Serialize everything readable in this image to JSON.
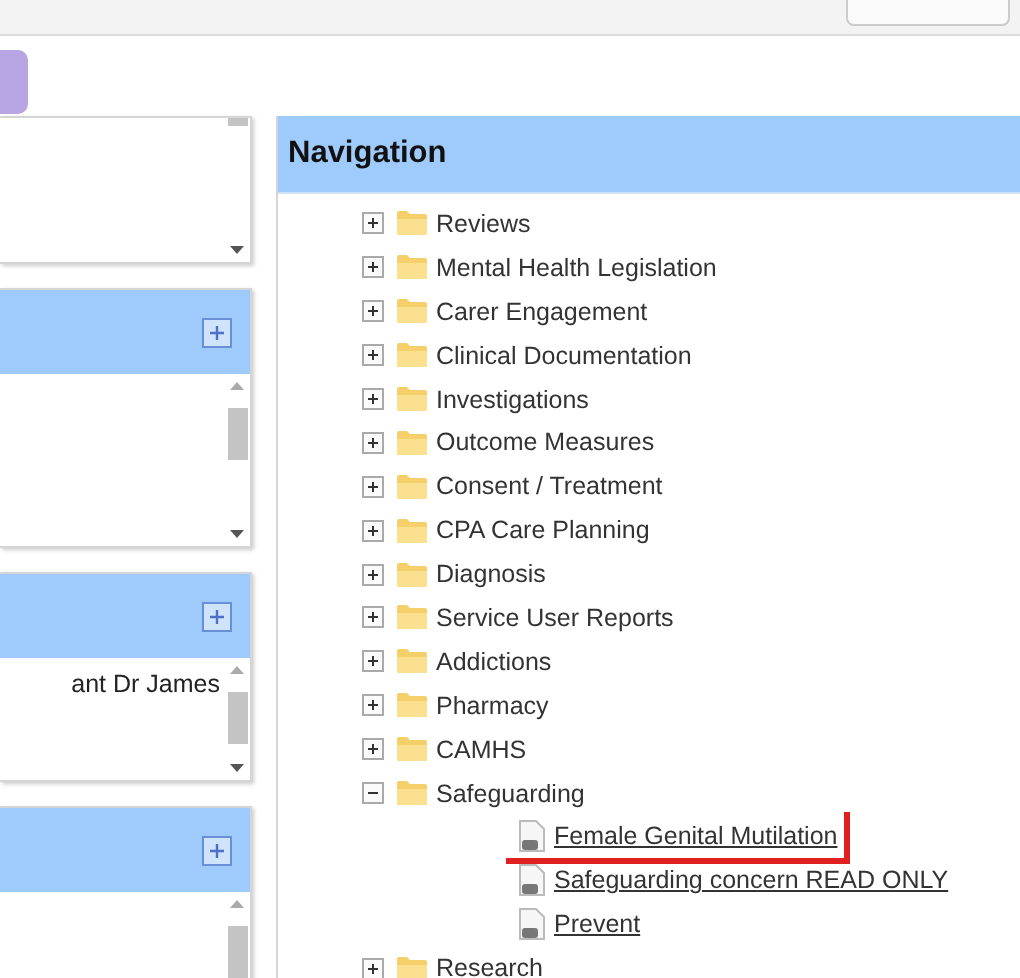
{
  "left_panels": [
    {
      "kind": "plain"
    },
    {
      "kind": "headed"
    },
    {
      "kind": "headed",
      "lines": [
        "ant Dr James"
      ]
    },
    {
      "kind": "headed"
    }
  ],
  "navigation": {
    "title": "Navigation",
    "items": [
      {
        "label": "Reviews",
        "kind": "folder",
        "expanded": false
      },
      {
        "label": "Mental Health Legislation",
        "kind": "folder",
        "expanded": false
      },
      {
        "label": "Carer Engagement",
        "kind": "folder",
        "expanded": false
      },
      {
        "label": "Clinical Documentation",
        "kind": "folder",
        "expanded": false
      },
      {
        "label": "Investigations",
        "kind": "folder",
        "expanded": false
      },
      {
        "label": "Outcome Measures",
        "kind": "folder",
        "expanded": false
      },
      {
        "label": "Consent / Treatment",
        "kind": "folder",
        "expanded": false
      },
      {
        "label": "CPA Care Planning",
        "kind": "folder",
        "expanded": false
      },
      {
        "label": "Diagnosis",
        "kind": "folder",
        "expanded": false
      },
      {
        "label": "Service User Reports",
        "kind": "folder",
        "expanded": false
      },
      {
        "label": "Addictions",
        "kind": "folder",
        "expanded": false
      },
      {
        "label": "Pharmacy",
        "kind": "folder",
        "expanded": false
      },
      {
        "label": "CAMHS",
        "kind": "folder",
        "expanded": false
      },
      {
        "label": "Safeguarding",
        "kind": "folder",
        "expanded": true,
        "children": [
          {
            "label": "Female Genital Mutilation",
            "kind": "document",
            "annotated": true
          },
          {
            "label": "Safeguarding concern READ ONLY",
            "kind": "document",
            "annotated": false
          },
          {
            "label": "Prevent",
            "kind": "document",
            "annotated": false
          }
        ]
      },
      {
        "label": "Research",
        "kind": "folder",
        "expanded": false
      }
    ]
  }
}
